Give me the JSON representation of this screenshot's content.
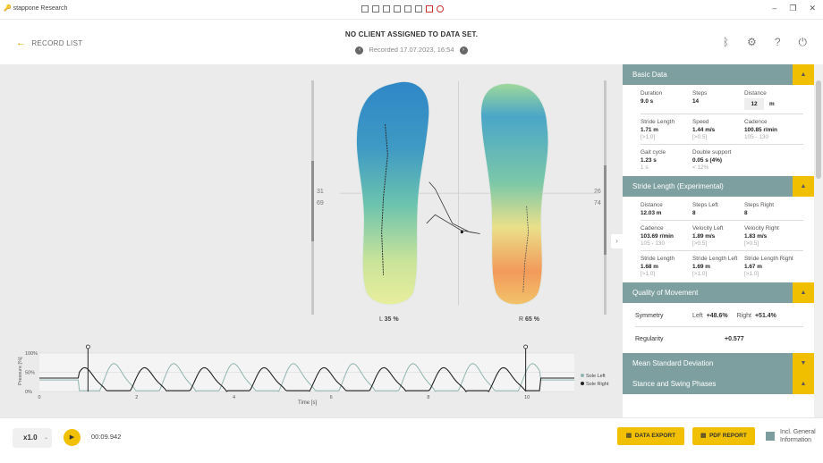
{
  "window": {
    "app_title": "stappone Research"
  },
  "header": {
    "back_label": "RECORD LIST",
    "title": "NO CLIENT ASSIGNED TO DATA SET.",
    "recorded": "Recorded 17.07.2023, 16:54"
  },
  "feet": {
    "left_top": "31",
    "left_bottom": "69",
    "right_top": "26",
    "right_bottom": "74",
    "left_label": "L",
    "left_pct": "35 %",
    "right_label": "R",
    "right_pct": "65 %"
  },
  "chart_data": {
    "type": "line",
    "xlabel": "Time [s]",
    "ylabel": "Pressure [%]",
    "y_ticks": [
      "100%",
      "50%",
      "0%"
    ],
    "x_ticks": [
      "0",
      "2",
      "4",
      "6",
      "8",
      "10"
    ],
    "xlim": [
      0,
      11
    ],
    "ylim": [
      0,
      100
    ],
    "markers": [
      1,
      10
    ],
    "series": [
      {
        "name": "Sole Left",
        "color": "#8fb5b0"
      },
      {
        "name": "Sole Right",
        "color": "#222222"
      }
    ]
  },
  "sidebar": {
    "basic": {
      "title": "Basic Data",
      "rows": [
        [
          {
            "k": "Duration",
            "v": "9.0 s"
          },
          {
            "k": "Steps",
            "v": "14"
          },
          {
            "k": "Distance",
            "v": "12",
            "u": "m"
          }
        ],
        [
          {
            "k": "Stride Length",
            "v": "1.71 m",
            "r": "[>1.0]"
          },
          {
            "k": "Speed",
            "v": "1.44 m/s",
            "r": "[>0.5]"
          },
          {
            "k": "Cadence",
            "v": "100.85 r/min",
            "r": "105 - 130"
          }
        ],
        [
          {
            "k": "Gait cycle",
            "v": "1.23 s",
            "r": "1 s"
          },
          {
            "k": "Double support",
            "v": "0.05 s (4%)",
            "r": "< 12%"
          },
          {
            "k": "",
            "v": ""
          }
        ]
      ]
    },
    "stride": {
      "title": "Stride Length (Experimental)",
      "rows": [
        [
          {
            "k": "Distance",
            "v": "12.03 m"
          },
          {
            "k": "Steps Left",
            "v": "8"
          },
          {
            "k": "Steps Right",
            "v": "8"
          }
        ],
        [
          {
            "k": "Cadence",
            "v": "103.69 r/min",
            "r": "105 - 130"
          },
          {
            "k": "Velocity Left",
            "v": "1.89 m/s",
            "r": "[>0.5]"
          },
          {
            "k": "Velocity Right",
            "v": "1.83 m/s",
            "r": "[>0.5]"
          }
        ],
        [
          {
            "k": "Stride Length",
            "v": "1.68 m",
            "r": "[>1.0]"
          },
          {
            "k": "Stride Length Left",
            "v": "1.69 m",
            "r": "[>1.0]"
          },
          {
            "k": "Stride Length Right",
            "v": "1.67 m",
            "r": "[>1.0]"
          }
        ]
      ]
    },
    "quality": {
      "title": "Quality of Movement",
      "symmetry": "Symmetry",
      "left_label": "Left",
      "left_val": "+48.6%",
      "right_label": "Right",
      "right_val": "+51.4%",
      "regularity": "Regularity",
      "regularity_val": "+0.577"
    },
    "mean_std": {
      "title": "Mean Standard Deviation"
    },
    "stance": {
      "title": "Stance and Swing Phases"
    }
  },
  "footer": {
    "speed": "x1.0",
    "time": "00:09.942",
    "data_export": "DATA EXPORT",
    "pdf_report": "PDF REPORT",
    "incl_line1": "Incl. General",
    "incl_line2": "Information"
  },
  "colors": {
    "accent": "#f1c000",
    "section": "#7e9fa0"
  }
}
